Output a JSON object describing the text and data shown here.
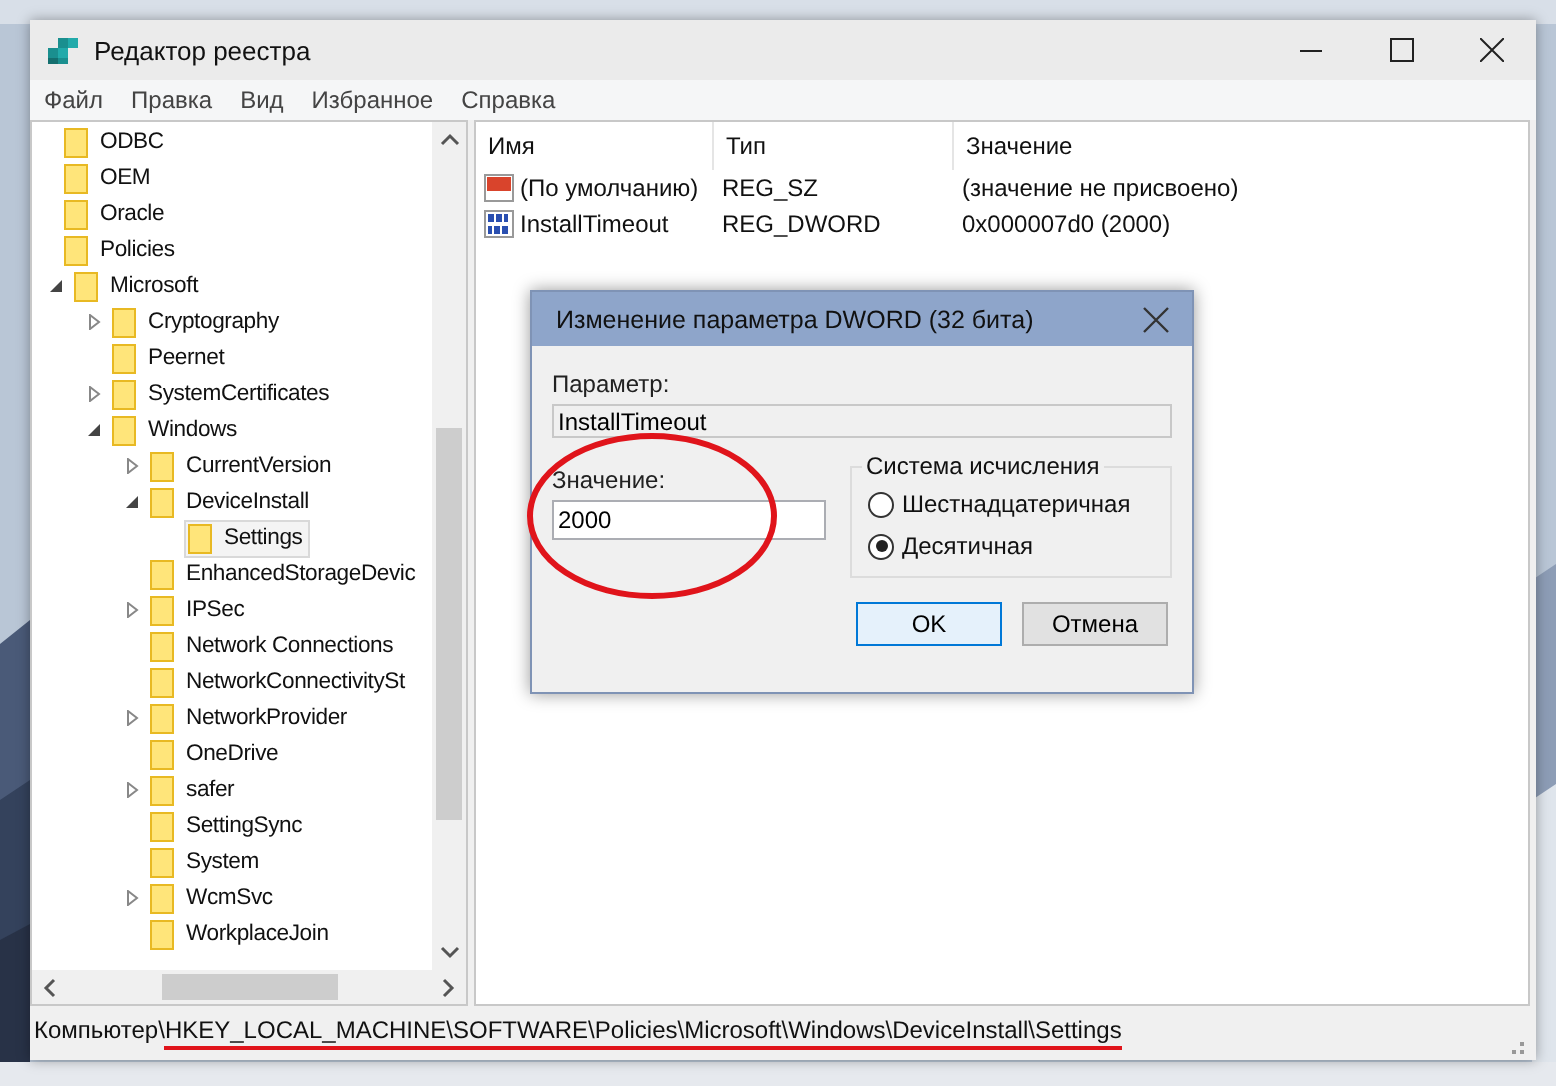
{
  "window": {
    "title": "Редактор реестра"
  },
  "menu": [
    "Файл",
    "Правка",
    "Вид",
    "Избранное",
    "Справка"
  ],
  "tree": [
    {
      "label": "ODBC",
      "selected": false
    },
    {
      "label": "OEM",
      "selected": false
    },
    {
      "label": "Oracle",
      "selected": false
    },
    {
      "label": "Policies",
      "selected": false,
      "children": [
        {
          "label": "Microsoft",
          "selected": false,
          "expanded": true,
          "children": [
            {
              "label": "Cryptography",
              "selected": false,
              "expanded": false
            },
            {
              "label": "Peernet",
              "selected": false
            },
            {
              "label": "SystemCertificates",
              "selected": false,
              "expanded": false
            },
            {
              "label": "Windows",
              "selected": false,
              "expanded": true,
              "children": [
                {
                  "label": "CurrentVersion",
                  "selected": false,
                  "expanded": false
                },
                {
                  "label": "DeviceInstall",
                  "selected": false,
                  "expanded": true,
                  "children": [
                    {
                      "label": "Settings",
                      "selected": true
                    }
                  ]
                },
                {
                  "label": "EnhancedStorageDevic",
                  "selected": false
                },
                {
                  "label": "IPSec",
                  "selected": false,
                  "expanded": false
                },
                {
                  "label": "Network Connections",
                  "selected": false
                },
                {
                  "label": "NetworkConnectivitySt",
                  "selected": false
                },
                {
                  "label": "NetworkProvider",
                  "selected": false,
                  "expanded": false
                },
                {
                  "label": "OneDrive",
                  "selected": false
                },
                {
                  "label": "safer",
                  "selected": false,
                  "expanded": false
                },
                {
                  "label": "SettingSync",
                  "selected": false
                },
                {
                  "label": "System",
                  "selected": false
                },
                {
                  "label": "WcmSvc",
                  "selected": false,
                  "expanded": false
                },
                {
                  "label": "WorkplaceJoin",
                  "selected": false
                }
              ]
            }
          ]
        }
      ]
    }
  ],
  "table": {
    "columns": [
      "Имя",
      "Тип",
      "Значение"
    ],
    "rows": [
      {
        "kind": "string",
        "name": "(По умолчанию)",
        "type": "REG_SZ",
        "value": "(значение не присвоено)"
      },
      {
        "kind": "binary",
        "name": "InstallTimeout",
        "type": "REG_DWORD",
        "value": "0x000007d0 (2000)"
      }
    ]
  },
  "dialog": {
    "title": "Изменение параметра DWORD (32 бита)",
    "param_label": "Параметр:",
    "param_value": "InstallTimeout",
    "value_label": "Значение:",
    "value": "2000",
    "circled": true,
    "base_group": "Система исчисления",
    "radios": [
      {
        "label": "Шестнадцатеричная",
        "selected": false
      },
      {
        "label": "Десятичная",
        "selected": true
      }
    ],
    "buttons": [
      {
        "label": "OK",
        "default": true
      },
      {
        "label": "Отмена",
        "default": false
      }
    ]
  },
  "status_bar": {
    "prefix": "Компьютер\\",
    "path": "HKEY_LOCAL_MACHINE\\SOFTWARE\\Policies\\Microsoft\\Windows\\DeviceInstall\\Settings",
    "underlined": true
  }
}
